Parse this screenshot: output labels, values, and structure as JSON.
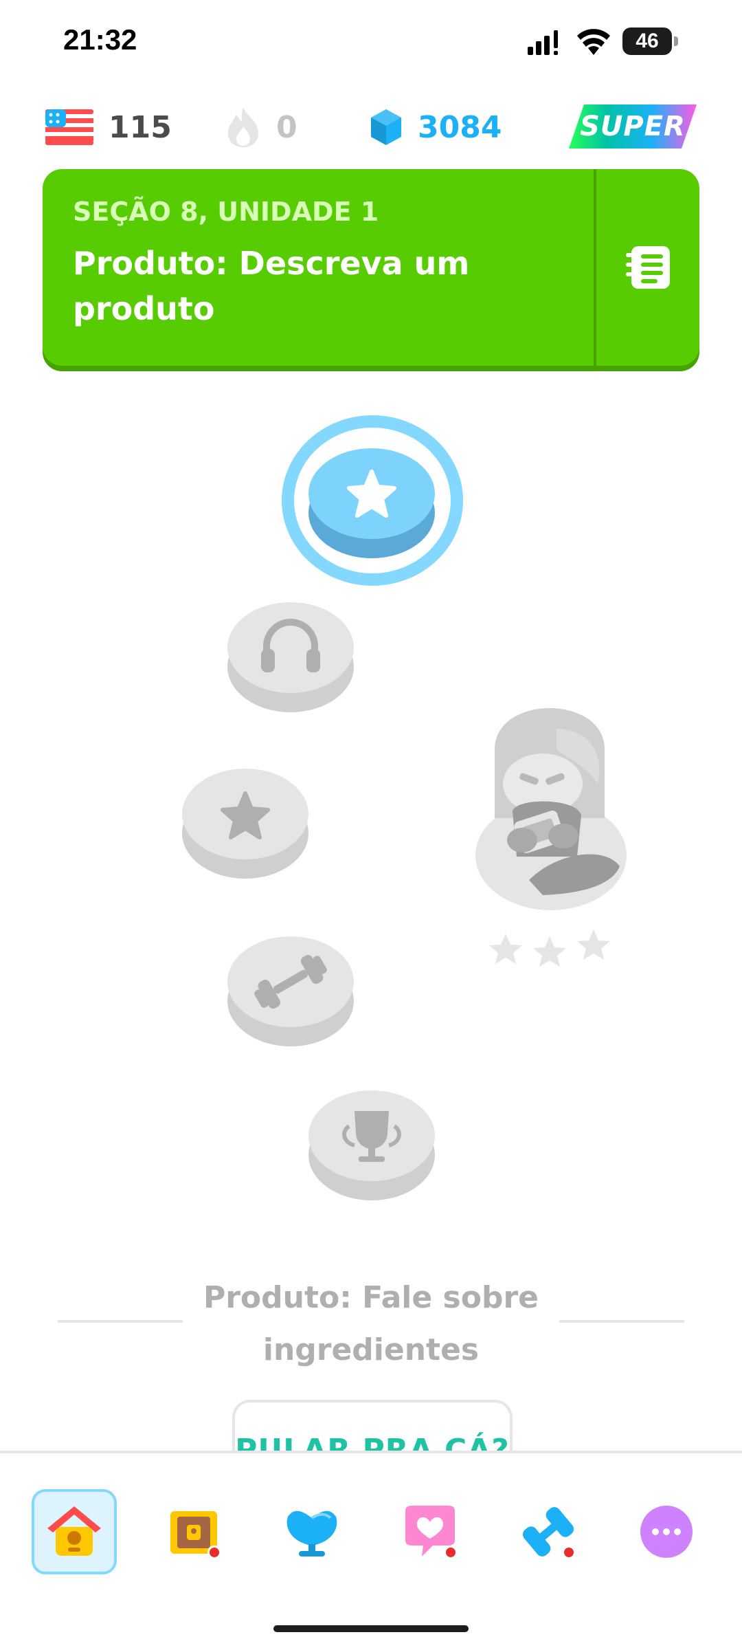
{
  "status_bar": {
    "time": "21:32",
    "battery": "46"
  },
  "stats": {
    "language_flag": "us-flag-icon",
    "crowns": "115",
    "streak": "0",
    "gems": "3084",
    "super_label": "SUPER"
  },
  "banner": {
    "subtitle": "SEÇÃO 8, UNIDADE 1",
    "title": "Produto: Descreva um produto",
    "color": "#58cc02"
  },
  "path": {
    "nodes": [
      {
        "icon": "star-icon",
        "state": "active"
      },
      {
        "icon": "headphones-icon",
        "state": "locked"
      },
      {
        "icon": "star-icon",
        "state": "locked"
      },
      {
        "icon": "dumbbell-icon",
        "state": "locked"
      },
      {
        "icon": "trophy-icon",
        "state": "locked"
      }
    ]
  },
  "next_unit": {
    "title": "Produto: Fale sobre ingredientes",
    "jump_label": "PULAR PRA CÁ?"
  },
  "nav": {
    "items": [
      {
        "icon": "home-icon",
        "active": true
      },
      {
        "icon": "treasure-chest-icon",
        "badge": true
      },
      {
        "icon": "shield-icon"
      },
      {
        "icon": "heart-message-icon",
        "badge": true
      },
      {
        "icon": "dumbbell-icon",
        "badge": true
      },
      {
        "icon": "more-icon"
      }
    ]
  },
  "colors": {
    "accent_blue": "#1cb0f6",
    "active_node": "#7dd3fc",
    "locked_node": "#e5e5e5",
    "jump_text": "#1fc2a4"
  }
}
